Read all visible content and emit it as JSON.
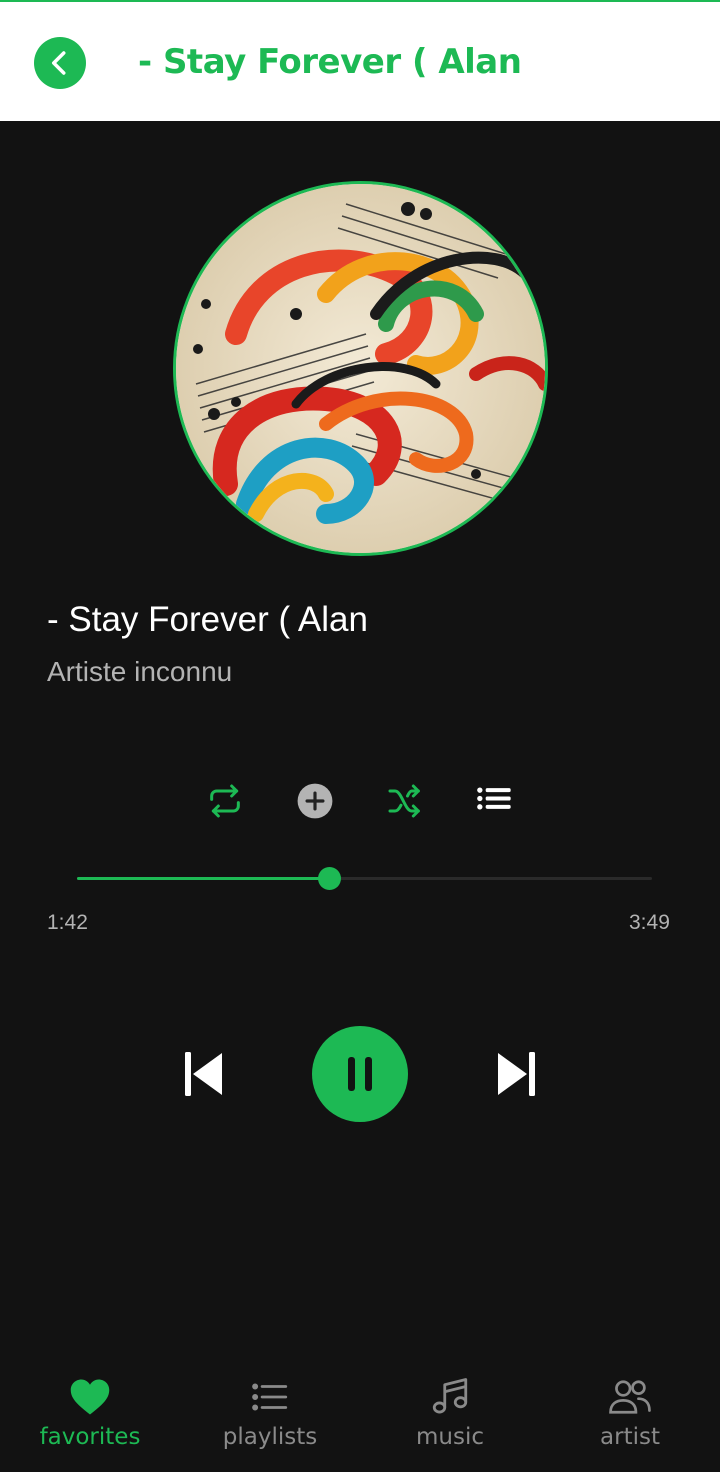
{
  "header": {
    "title": "- Stay Forever ( Alan",
    "back_icon": "chevron-left-icon"
  },
  "player": {
    "song_title": "- Stay Forever ( Alan",
    "artist": "Artiste inconnu",
    "elapsed": "1:42",
    "duration": "3:49",
    "progress_fraction": 0.438,
    "state": "playing"
  },
  "controls": {
    "icons": [
      "repeat-icon",
      "add-icon",
      "shuffle-icon",
      "queue-list-icon"
    ],
    "transport_icons": [
      "skip-previous-icon",
      "pause-icon",
      "skip-next-icon"
    ]
  },
  "bottom_nav": {
    "items": [
      {
        "label": "favorites",
        "icon": "heart-icon",
        "active": true
      },
      {
        "label": "playlists",
        "icon": "list-icon",
        "active": false
      },
      {
        "label": "music",
        "icon": "music-note-icon",
        "active": false
      },
      {
        "label": "artist",
        "icon": "people-icon",
        "active": false
      }
    ]
  },
  "colors": {
    "accent": "#1db954",
    "background": "#121212",
    "header_bg": "#ffffff",
    "text_primary": "#ffffff",
    "text_secondary": "#b3b3b3",
    "nav_inactive": "#8a8a8a"
  }
}
